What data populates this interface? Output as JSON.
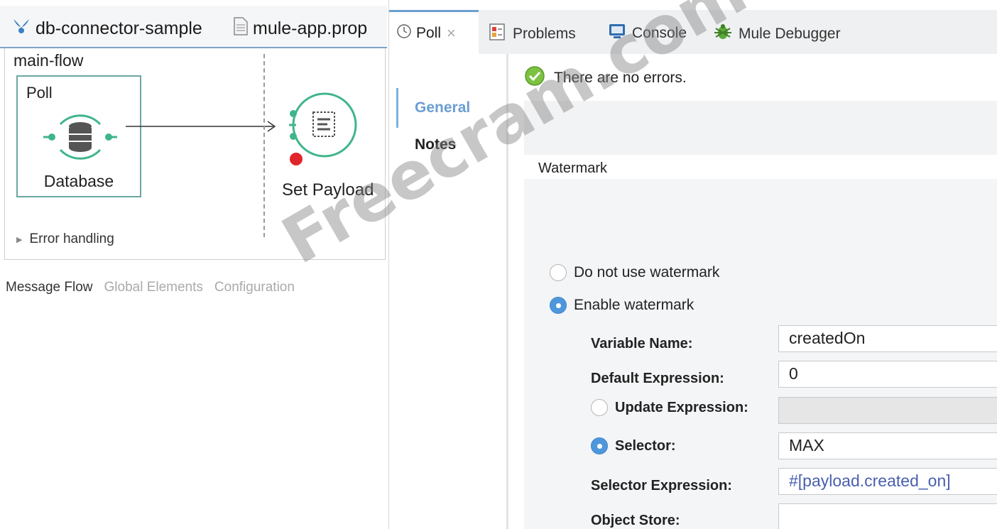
{
  "editor": {
    "project_tab": "db-connector-sample",
    "props_tab": "mule-app.prop",
    "flow_name": "main-flow",
    "poll_label": "Poll",
    "db_label": "Database",
    "payload_label": "Set Payload",
    "error_handling": "Error handling",
    "bottom_tabs": {
      "message_flow": "Message Flow",
      "global_elements": "Global Elements",
      "configuration": "Configuration"
    }
  },
  "views": {
    "poll": "Poll",
    "problems": "Problems",
    "console": "Console",
    "debugger": "Mule Debugger"
  },
  "side_nav": {
    "general": "General",
    "notes": "Notes"
  },
  "status": "There are no errors.",
  "watermark": {
    "header": "Watermark",
    "no_watermark": "Do not use watermark",
    "enable_watermark": "Enable watermark",
    "selected": "enable",
    "variable_name_label": "Variable Name:",
    "variable_name_value": "createdOn",
    "default_expression_label": "Default Expression:",
    "default_expression_value": "0",
    "update_expression_label": "Update Expression:",
    "update_expression_value": "",
    "selector_label": "Selector:",
    "selector_value": "MAX",
    "selector_expression_label": "Selector Expression:",
    "selector_expression_value": "#[payload.created_on]",
    "object_store_label": "Object Store:",
    "object_store_value": ""
  },
  "overlay_text": "Freecram.com",
  "colors": {
    "accent": "#4f97dc",
    "flow_green": "#3fb58a",
    "breakpoint": "#e0262a",
    "status_ok": "#7cc242"
  }
}
